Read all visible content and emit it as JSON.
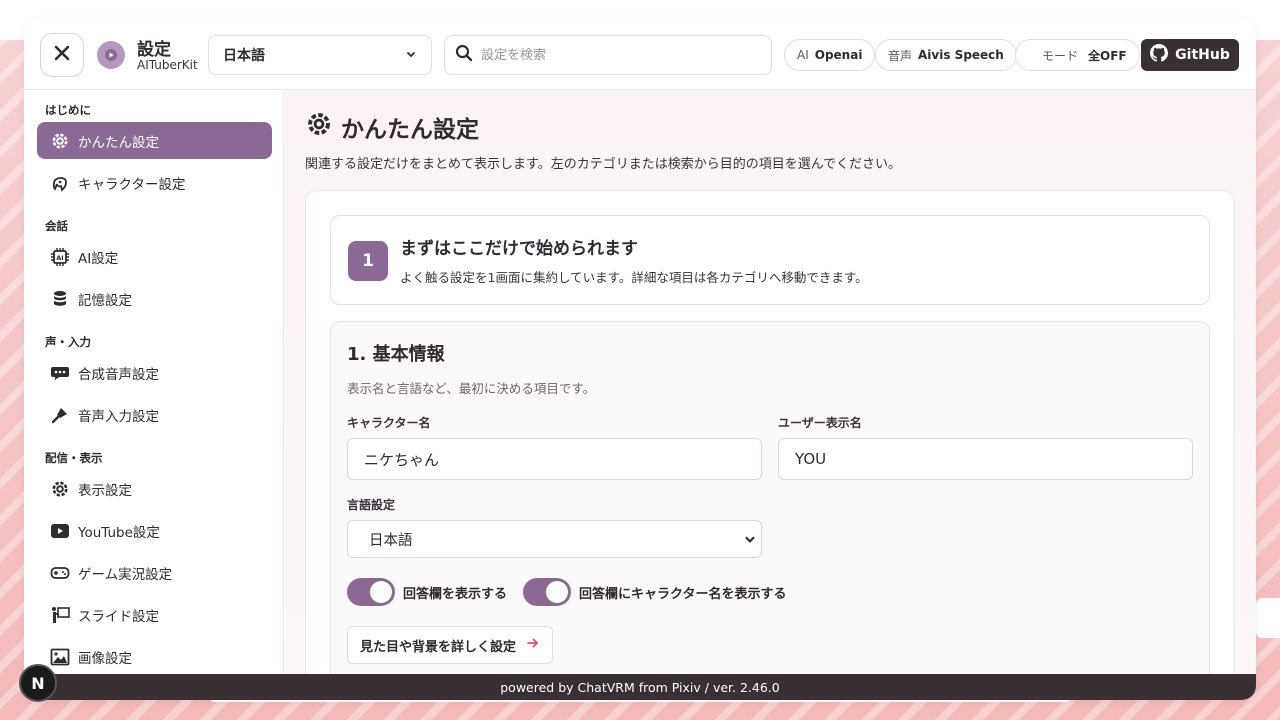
{
  "header": {
    "title": "設定",
    "subtitle": "AITuberKit",
    "language_select": "日本語",
    "search_placeholder": "設定を検索",
    "ai_pill": {
      "key": "AI",
      "value": "Openai"
    },
    "voice_pill": {
      "key": "音声",
      "value": "Aivis Speech"
    },
    "mode_pill": {
      "key": "モード",
      "value": "全OFF"
    },
    "github_label": "GitHub"
  },
  "sidebar": {
    "sections": [
      {
        "label": "はじめに"
      },
      {
        "label": "会話"
      },
      {
        "label": "声・入力"
      },
      {
        "label": "配信・表示"
      }
    ],
    "items": [
      {
        "label": "かんたん設定",
        "icon": "gear-icon"
      },
      {
        "label": "キャラクター設定",
        "icon": "character-icon"
      },
      {
        "label": "AI設定",
        "icon": "chip-icon"
      },
      {
        "label": "記憶設定",
        "icon": "database-icon"
      },
      {
        "label": "合成音声設定",
        "icon": "chat-icon"
      },
      {
        "label": "音声入力設定",
        "icon": "microphone-icon"
      },
      {
        "label": "表示設定",
        "icon": "gear-icon"
      },
      {
        "label": "YouTube設定",
        "icon": "youtube-icon"
      },
      {
        "label": "ゲーム実況設定",
        "icon": "gamepad-icon"
      },
      {
        "label": "スライド設定",
        "icon": "presentation-icon"
      },
      {
        "label": "画像設定",
        "icon": "image-icon"
      }
    ]
  },
  "main": {
    "title": "かんたん設定",
    "description": "関連する設定だけをまとめて表示します。左のカテゴリまたは検索から目的の項目を選んでください。",
    "step": {
      "number": "1",
      "title": "まずはここだけで始められます",
      "description": "よく触る設定を1画面に集約しています。詳細な項目は各カテゴリへ移動できます。"
    },
    "basic": {
      "title": "1. 基本情報",
      "description": "表示名と言語など、最初に決める項目です。",
      "character_name_label": "キャラクター名",
      "character_name_value": "ニケちゃん",
      "user_name_label": "ユーザー表示名",
      "user_name_value": "YOU",
      "language_label": "言語設定",
      "language_value": "日本語",
      "toggle1_label": "回答欄を表示する",
      "toggle2_label": "回答欄にキャラクター名を表示する",
      "detail_button": "見た目や背景を詳しく設定"
    }
  },
  "footer": {
    "text": "powered by ChatVRM from Pixiv / ver. 2.46.0"
  },
  "badge": {
    "text": "N"
  },
  "colors": {
    "accent": "#8a6a94",
    "footer": "#3a3034",
    "arrow": "#e0506a"
  }
}
